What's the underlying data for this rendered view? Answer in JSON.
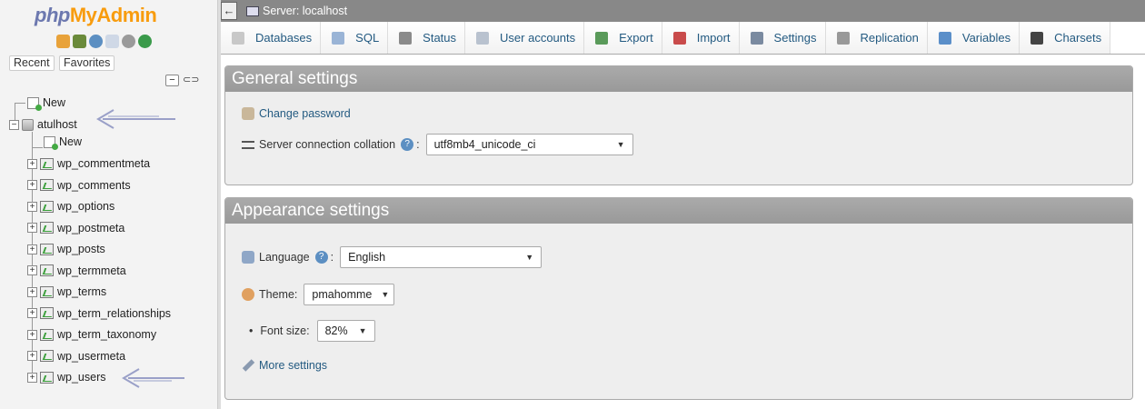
{
  "nav": {
    "logo_php": "php",
    "logo_myadmin": "MyAdmin",
    "recent_tab": "Recent",
    "favorites_tab": "Favorites",
    "collapse_all": "−",
    "tree": {
      "new_root": "New",
      "server_db": "atulhost",
      "new_table": "New",
      "tables": [
        "wp_commentmeta",
        "wp_comments",
        "wp_options",
        "wp_postmeta",
        "wp_posts",
        "wp_termmeta",
        "wp_terms",
        "wp_term_relationships",
        "wp_term_taxonomy",
        "wp_usermeta",
        "wp_users"
      ]
    }
  },
  "topbar": {
    "back_label": "←",
    "server_label": "Server: localhost"
  },
  "menu": {
    "tabs": [
      {
        "label": "Databases",
        "icon": "database-icon",
        "color": "#c8c8c8"
      },
      {
        "label": "SQL",
        "icon": "sql-icon",
        "color": "#9ab4d6"
      },
      {
        "label": "Status",
        "icon": "status-icon",
        "color": "#8a8a8a"
      },
      {
        "label": "User accounts",
        "icon": "users-icon",
        "color": "#b9c2cf"
      },
      {
        "label": "Export",
        "icon": "export-icon",
        "color": "#5a9a5a"
      },
      {
        "label": "Import",
        "icon": "import-icon",
        "color": "#c94b4b"
      },
      {
        "label": "Settings",
        "icon": "wrench-icon",
        "color": "#7a8aa0"
      },
      {
        "label": "Replication",
        "icon": "replication-icon",
        "color": "#999999"
      },
      {
        "label": "Variables",
        "icon": "variables-icon",
        "color": "#5b8fc9"
      },
      {
        "label": "Charsets",
        "icon": "charsets-icon",
        "color": "#444444"
      }
    ]
  },
  "general": {
    "title": "General settings",
    "change_password": "Change password",
    "collation_label": "Server connection collation",
    "collation_value": "utf8mb4_unicode_ci"
  },
  "appearance": {
    "title": "Appearance settings",
    "language_label": "Language",
    "language_value": "English",
    "theme_label": "Theme:",
    "theme_value": "pmahomme",
    "fontsize_label": "Font size:",
    "fontsize_value": "82%",
    "more_settings": "More settings"
  },
  "help_glyph": "?",
  "colon": ":"
}
